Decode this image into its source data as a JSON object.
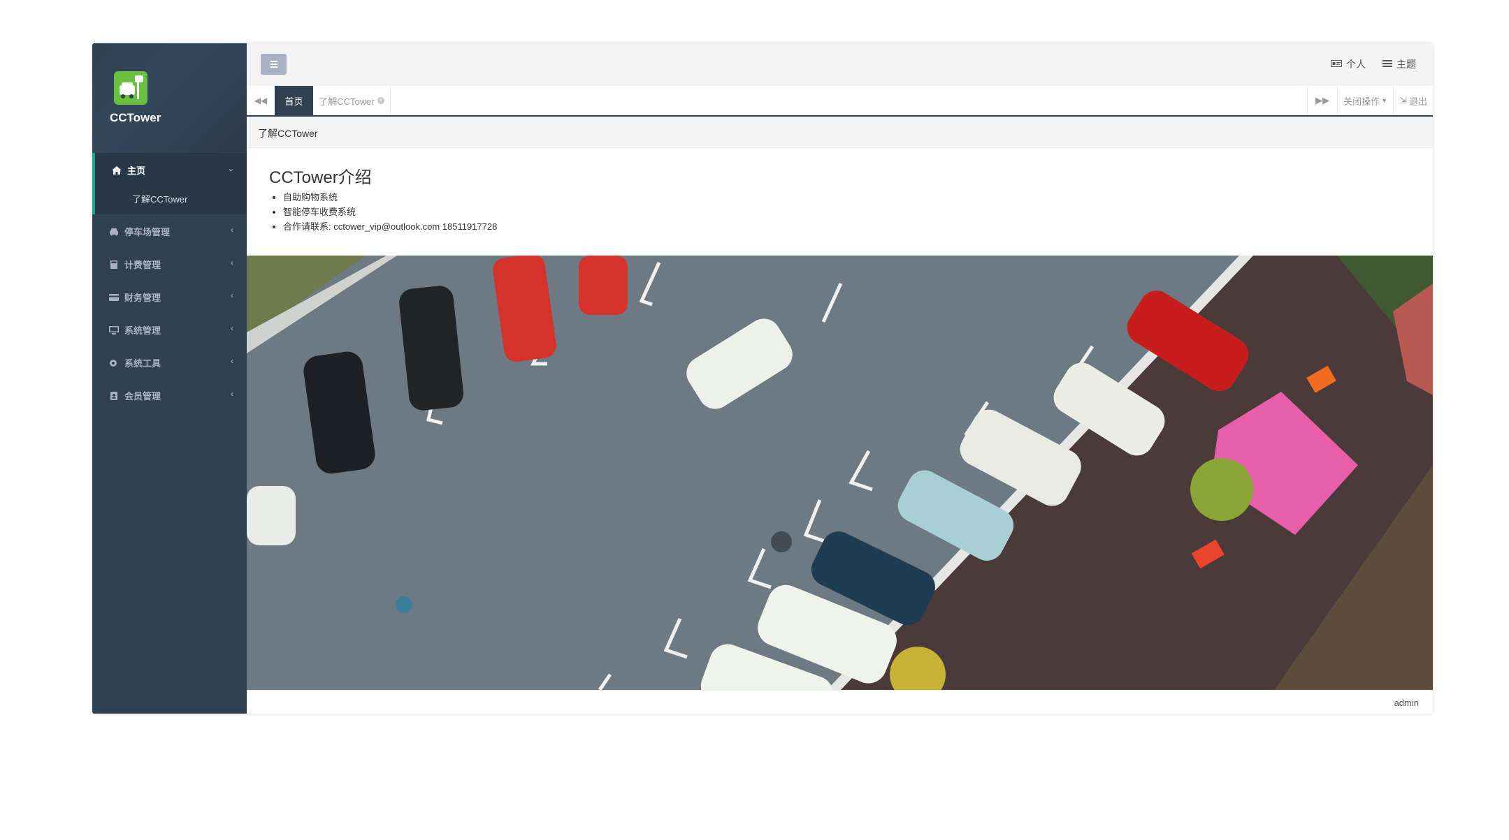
{
  "app": {
    "name": "CCTower"
  },
  "sidebar": {
    "home_label": "主页",
    "home_sub": "了解CCTower",
    "items": [
      {
        "label": "停车场管理",
        "icon": "car-icon"
      },
      {
        "label": "计费管理",
        "icon": "calculator-icon"
      },
      {
        "label": "财务管理",
        "icon": "credit-card-icon"
      },
      {
        "label": "系统管理",
        "icon": "desktop-icon"
      },
      {
        "label": "系统工具",
        "icon": "gear-icon"
      },
      {
        "label": "会员管理",
        "icon": "address-book-icon"
      }
    ]
  },
  "topbar": {
    "personal": "个人",
    "theme": "主题"
  },
  "tabs": {
    "home": "首页",
    "about": "了解CCTower",
    "close_ops": "关闭操作",
    "logout": "退出"
  },
  "breadcrumb": "了解CCTower",
  "main": {
    "title": "CCTower介绍",
    "bullets": [
      "自助购物系统",
      "智能停车收费系统",
      "合作请联系: cctower_vip@outlook.com 18511917728"
    ]
  },
  "footer": {
    "user": "admin"
  },
  "colors": {
    "sidebar": "#2f4050",
    "accent": "#19aa8d",
    "logo": "#6abf3f"
  }
}
